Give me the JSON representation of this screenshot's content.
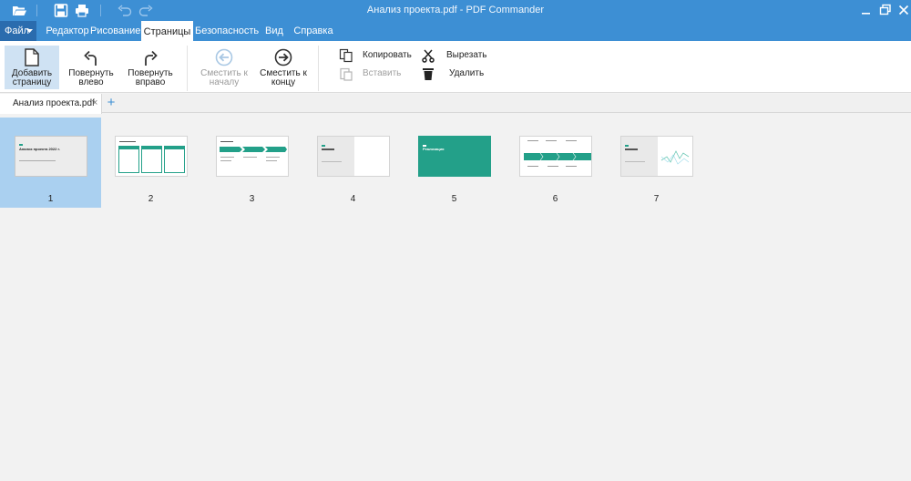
{
  "window": {
    "title": "Анализ проекта.pdf - PDF Commander"
  },
  "menu": {
    "file": "Файл",
    "tabs": [
      "Редактор",
      "Рисование",
      "Страницы",
      "Безопасность",
      "Вид",
      "Справка"
    ],
    "active_tab": "Страницы"
  },
  "ribbon": {
    "add_page": [
      "Добавить",
      "страницу"
    ],
    "rotate_left": [
      "Повернуть",
      "влево"
    ],
    "rotate_right": [
      "Повернуть",
      "вправо"
    ],
    "move_start": [
      "Сместить к",
      "началу"
    ],
    "move_end": [
      "Сместить к",
      "концу"
    ],
    "copy": "Копировать",
    "paste": "Вставить",
    "cut": "Вырезать",
    "delete": "Удалить"
  },
  "document_tab": {
    "name": "Анализ проекта.pdf"
  },
  "thumbnails": {
    "t1": "Анализ проекта 2022 г.",
    "t5": "Реализация"
  },
  "pages": [
    "1",
    "2",
    "3",
    "4",
    "5",
    "6",
    "7"
  ],
  "colors": {
    "titlebar": "#3d8fd4",
    "accent_teal": "#23a089",
    "selection": "#aad0f0",
    "ribbon_selected": "#cfe2f3"
  }
}
